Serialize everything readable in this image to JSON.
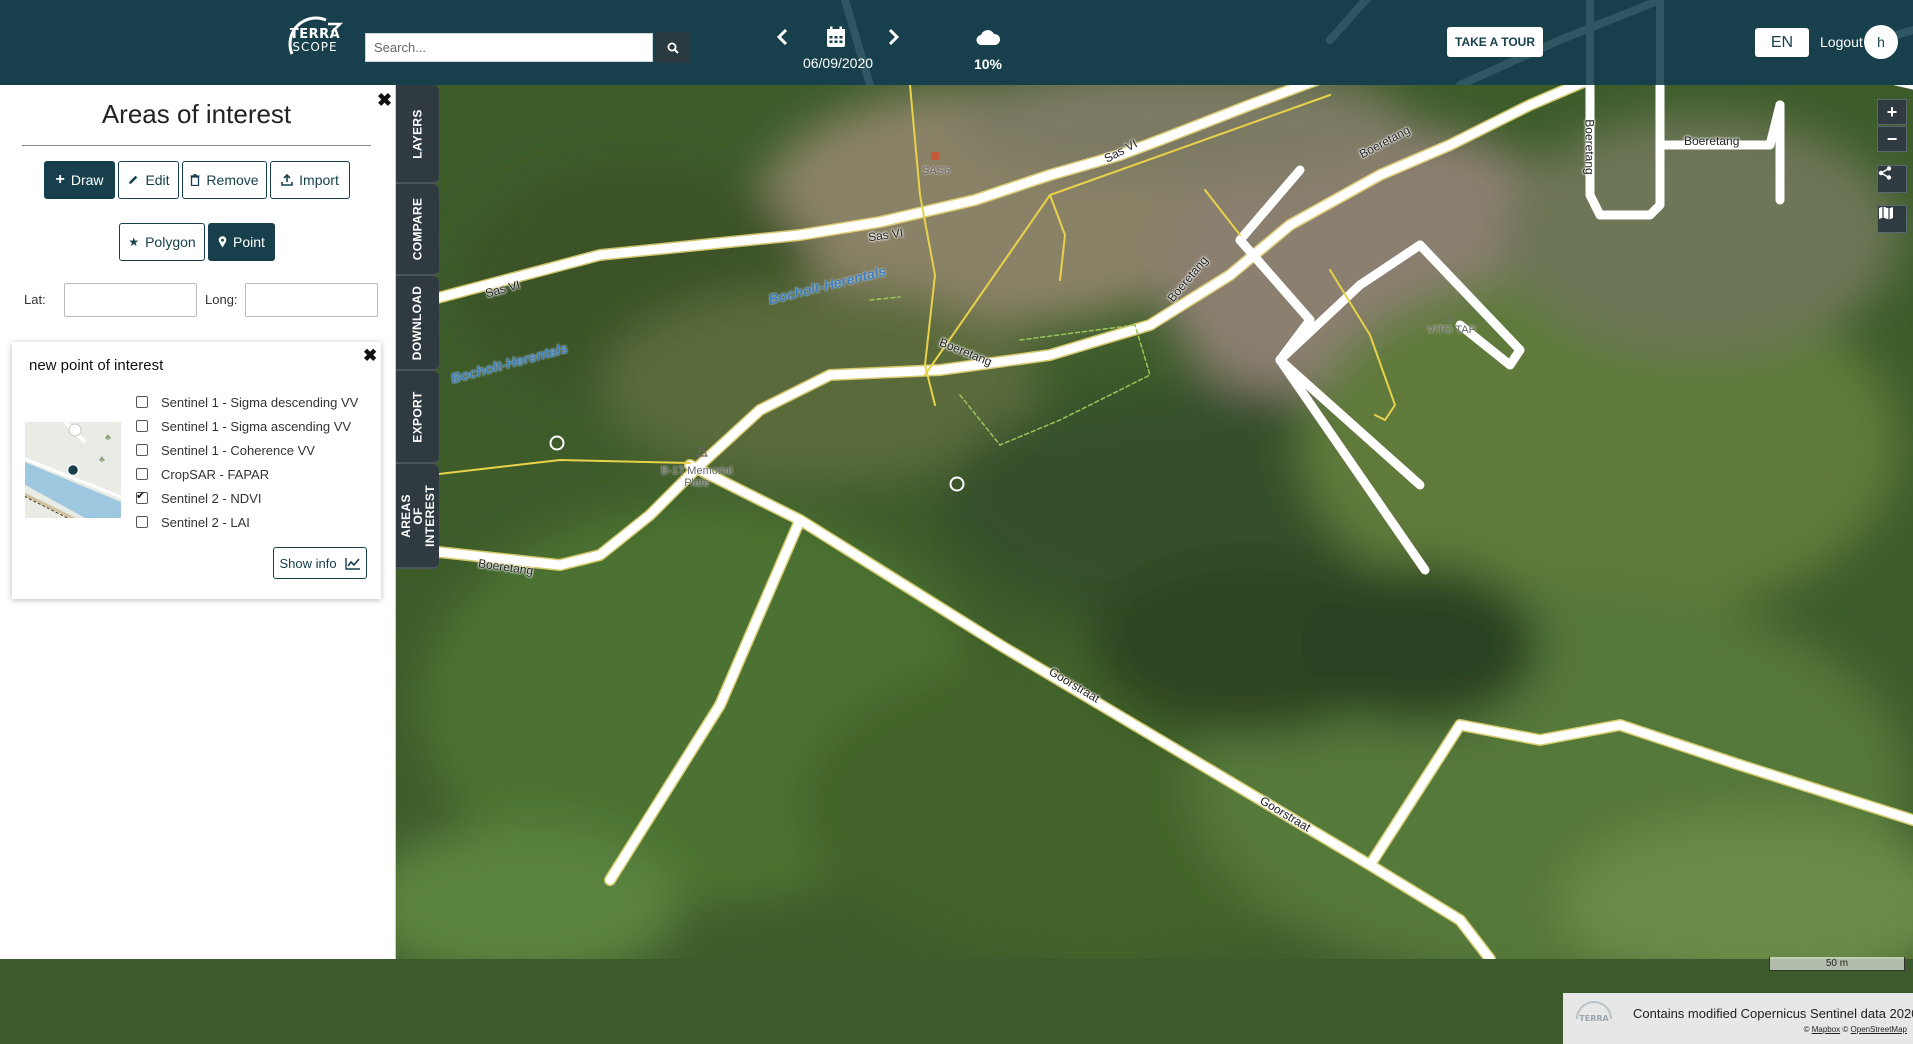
{
  "header": {
    "logo_line1": "TERRA",
    "logo_line2": "SCOPE",
    "search_placeholder": "Search...",
    "date": "06/09/2020",
    "cloud_cover": "10%",
    "tour_label": "TAKE A TOUR",
    "language": "EN",
    "logout_label": "Logout",
    "avatar_initial": "h"
  },
  "tabs": [
    "LAYERS",
    "COMPARE",
    "DOWNLOAD",
    "EXPORT",
    "AREAS OF INTEREST"
  ],
  "panel": {
    "title": "Areas of interest",
    "actions": [
      "Draw",
      "Edit",
      "Remove",
      "Import"
    ],
    "geometry_types": [
      "Polygon",
      "Point"
    ],
    "active_geometry": "Point",
    "lat_label": "Lat:",
    "long_label": "Long:",
    "lat_value": "",
    "long_value": ""
  },
  "poi_card": {
    "title": "new point of interest",
    "layers": [
      {
        "label": "Sentinel 1 - Sigma descending VV",
        "checked": false
      },
      {
        "label": "Sentinel 1 - Sigma ascending VV",
        "checked": false
      },
      {
        "label": "Sentinel 1 - Coherence VV",
        "checked": false
      },
      {
        "label": "CropSAR - FAPAR",
        "checked": false
      },
      {
        "label": "Sentinel 2 - NDVI",
        "checked": true
      },
      {
        "label": "Sentinel 2 - LAI",
        "checked": false
      }
    ],
    "show_info_label": "Show info"
  },
  "map": {
    "labels": {
      "sas_vi": "Sas VI",
      "boeretang": "Boeretang",
      "goorstraat": "Goorstraat",
      "canal": "Bocholt-Herentals",
      "sas6": "SAS6",
      "vito_tap": "VITO TAP",
      "memorial_line1": "B-17 Memorial",
      "memorial_line2": "Plate"
    },
    "scale_label": "50 m",
    "attribution": "Contains modified Copernicus Sentinel data 2020",
    "attribution_small_prefix": "© ",
    "attribution_mapbox": "Mapbox",
    "attribution_sep": " © ",
    "attribution_osm": "OpenStreetMap"
  },
  "colors": {
    "brand": "#17404c",
    "tab_bg": "#2f3b40",
    "road": "#ffffff",
    "road_outline": "#ffe98a"
  }
}
